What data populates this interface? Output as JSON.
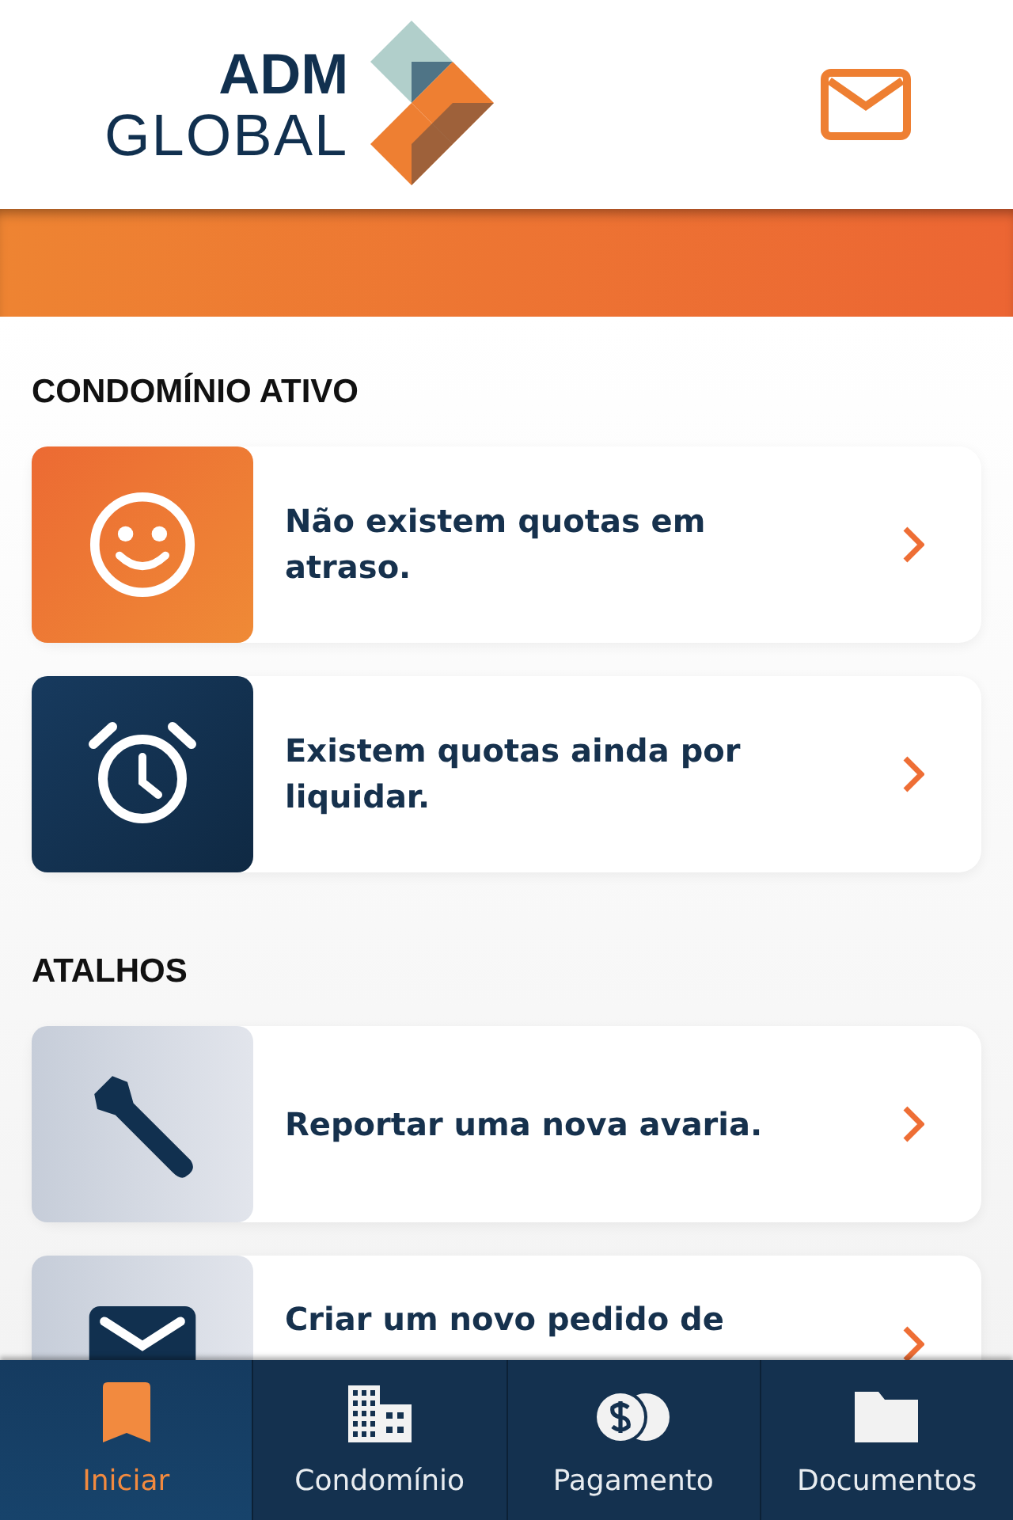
{
  "header": {
    "logo_top": "ADM",
    "logo_bottom": "GLOBAL"
  },
  "sections": [
    {
      "title": "CONDOMÍNIO ATIVO",
      "cards": [
        {
          "kind": "smile",
          "text": "Não existem quotas em atraso."
        },
        {
          "kind": "alarm",
          "text": "Existem quotas ainda por liquidar."
        }
      ]
    },
    {
      "title": "ATALHOS",
      "cards": [
        {
          "kind": "wrench",
          "text": "Reportar uma nova avaria."
        },
        {
          "kind": "mail",
          "text": "Criar um novo pedido de"
        }
      ]
    }
  ],
  "nav": [
    {
      "kind": "bookmark",
      "label": "Iniciar",
      "selected": true
    },
    {
      "kind": "building",
      "label": "Condomínio",
      "selected": false
    },
    {
      "kind": "coins",
      "label": "Pagamento",
      "selected": false
    },
    {
      "kind": "folder",
      "label": "Documentos",
      "selected": false
    }
  ]
}
